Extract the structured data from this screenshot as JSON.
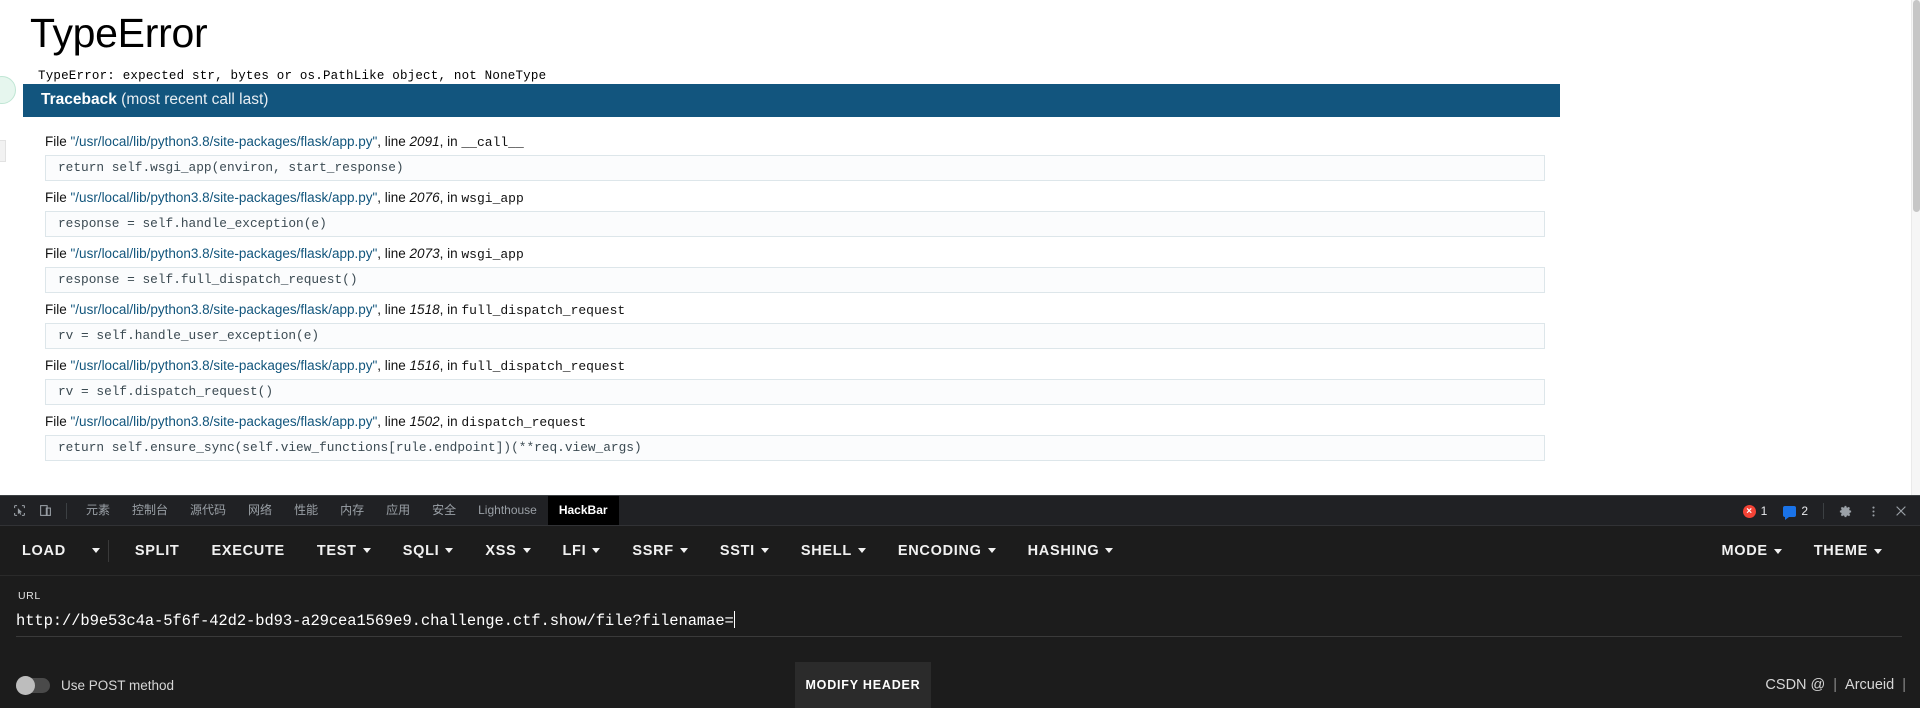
{
  "page": {
    "error_type": "TypeError",
    "error_message": "TypeError: expected str, bytes or os.PathLike object, not NoneType",
    "traceback_title": "Traceback",
    "traceback_subtitle": "(most recent call last)",
    "frames": [
      {
        "file_prefix": "File ",
        "path": "\"/usr/local/lib/python3.8/site-packages/flask/app.py\"",
        "line_label": ", line ",
        "line_no": "2091",
        "in_label": ", in ",
        "func": "__call__",
        "code": "return self.wsgi_app(environ, start_response)"
      },
      {
        "file_prefix": "File ",
        "path": "\"/usr/local/lib/python3.8/site-packages/flask/app.py\"",
        "line_label": ", line ",
        "line_no": "2076",
        "in_label": ", in ",
        "func": "wsgi_app",
        "code": "response = self.handle_exception(e)"
      },
      {
        "file_prefix": "File ",
        "path": "\"/usr/local/lib/python3.8/site-packages/flask/app.py\"",
        "line_label": ", line ",
        "line_no": "2073",
        "in_label": ", in ",
        "func": "wsgi_app",
        "code": "response = self.full_dispatch_request()"
      },
      {
        "file_prefix": "File ",
        "path": "\"/usr/local/lib/python3.8/site-packages/flask/app.py\"",
        "line_label": ", line ",
        "line_no": "1518",
        "in_label": ", in ",
        "func": "full_dispatch_request",
        "code": "rv = self.handle_user_exception(e)"
      },
      {
        "file_prefix": "File ",
        "path": "\"/usr/local/lib/python3.8/site-packages/flask/app.py\"",
        "line_label": ", line ",
        "line_no": "1516",
        "in_label": ", in ",
        "func": "full_dispatch_request",
        "code": "rv = self.dispatch_request()"
      },
      {
        "file_prefix": "File ",
        "path": "\"/usr/local/lib/python3.8/site-packages/flask/app.py\"",
        "line_label": ", line ",
        "line_no": "1502",
        "in_label": ", in ",
        "func": "dispatch_request",
        "code": "return self.ensure_sync(self.view_functions[rule.endpoint])(**req.view_args)"
      }
    ]
  },
  "devtools": {
    "tabs": [
      {
        "label": "元素",
        "active": false
      },
      {
        "label": "控制台",
        "active": false
      },
      {
        "label": "源代码",
        "active": false
      },
      {
        "label": "网络",
        "active": false
      },
      {
        "label": "性能",
        "active": false
      },
      {
        "label": "内存",
        "active": false
      },
      {
        "label": "应用",
        "active": false
      },
      {
        "label": "安全",
        "active": false
      },
      {
        "label": "Lighthouse",
        "active": false
      },
      {
        "label": "HackBar",
        "active": true
      }
    ],
    "error_count": "1",
    "message_count": "2"
  },
  "hackbar": {
    "menu": [
      {
        "label": "LOAD",
        "caret": false
      },
      {
        "label": "SPLIT",
        "caret": false
      },
      {
        "label": "EXECUTE",
        "caret": false
      },
      {
        "label": "TEST",
        "caret": true
      },
      {
        "label": "SQLI",
        "caret": true
      },
      {
        "label": "XSS",
        "caret": true
      },
      {
        "label": "LFI",
        "caret": true
      },
      {
        "label": "SSRF",
        "caret": true
      },
      {
        "label": "SSTI",
        "caret": true
      },
      {
        "label": "SHELL",
        "caret": true
      },
      {
        "label": "ENCODING",
        "caret": true
      },
      {
        "label": "HASHING",
        "caret": true
      }
    ],
    "mode_label": "MODE",
    "theme_label": "THEME",
    "url_label": "URL",
    "url_value": "http://b9e53c4a-5f6f-42d2-bd93-a29cea1569e9.challenge.ctf.show/file?filenamae=",
    "post_toggle_label": "Use POST method",
    "modify_header_label": "MODIFY HEADER"
  },
  "watermark": {
    "brand": "CSDN @",
    "separator": "|",
    "user": "Arcueid",
    "trailing": "|"
  },
  "colors": {
    "traceback_header_bg": "#12557e",
    "devtools_bg": "#202124",
    "hackbar_bg": "#1c1c1c",
    "error_badge": "#f44336",
    "message_badge": "#1a73e8"
  }
}
